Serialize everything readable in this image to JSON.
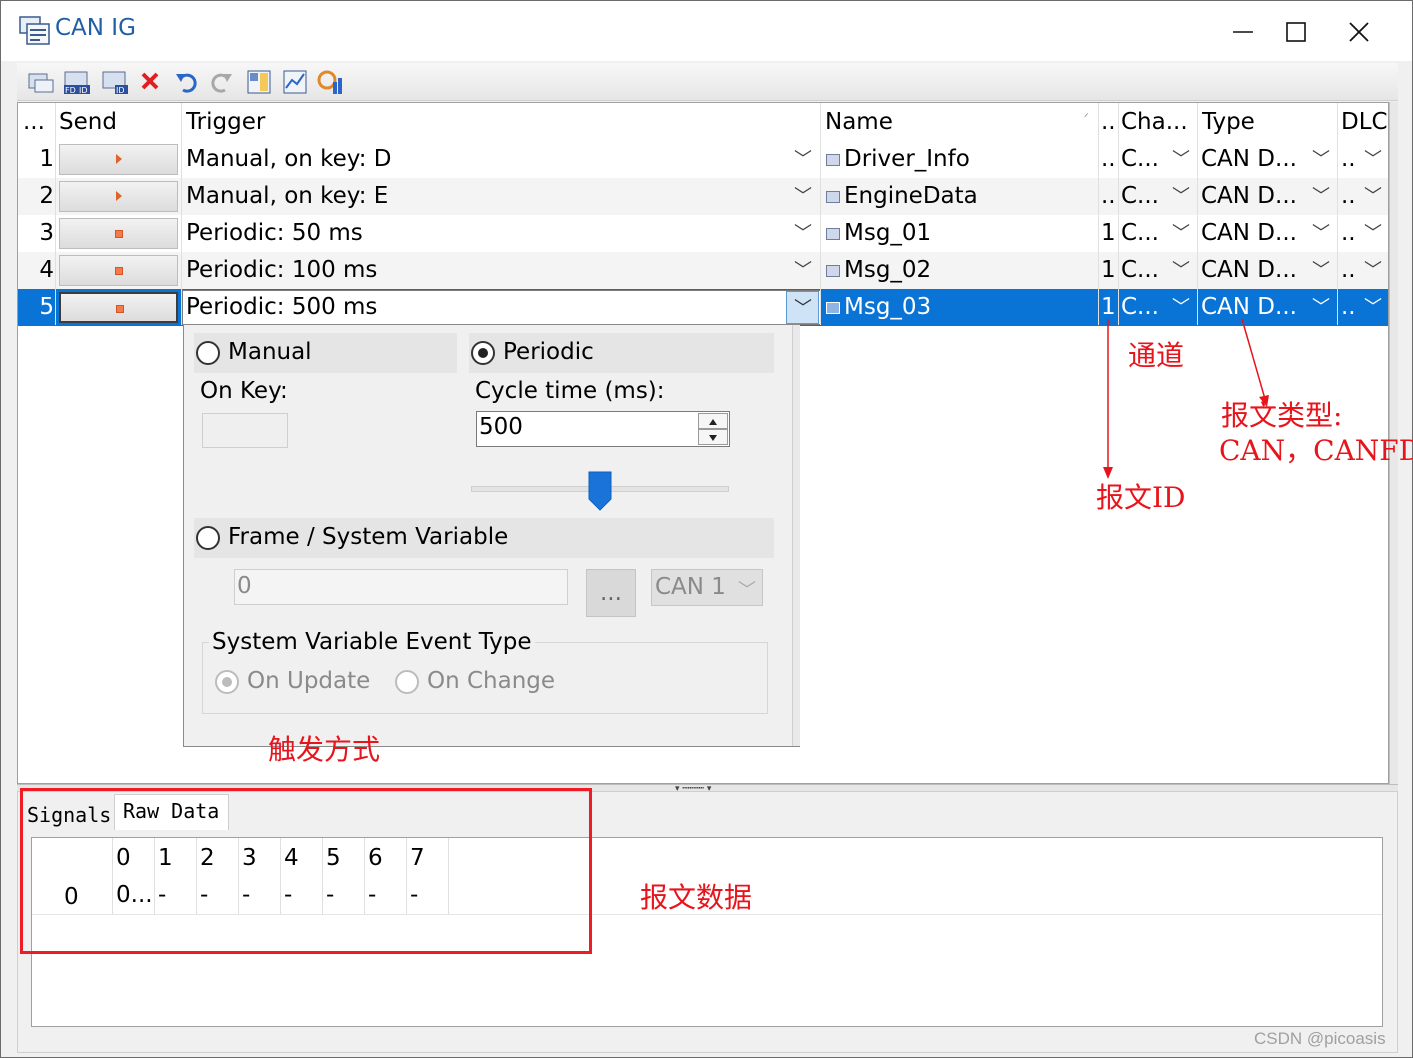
{
  "window": {
    "title": "CAN IG"
  },
  "columns": {
    "index": "...",
    "send": "Send",
    "trigger": "Trigger",
    "name": "Name",
    "id": "..",
    "channel": "Cha...",
    "type": "Type",
    "dlc": "DLC"
  },
  "rows": [
    {
      "index": "1",
      "send": "arrow",
      "trigger": "Manual, on key: D",
      "name": "Driver_Info",
      "id": "..",
      "channel": "C...",
      "type": "CAN D...",
      "dlc": ".."
    },
    {
      "index": "2",
      "send": "arrow",
      "trigger": "Manual, on key: E",
      "name": "EngineData",
      "id": "..",
      "channel": "C...",
      "type": "CAN D...",
      "dlc": ".."
    },
    {
      "index": "3",
      "send": "square",
      "trigger": "Periodic: 50 ms",
      "name": "Msg_01",
      "id": "1",
      "channel": "C...",
      "type": "CAN D...",
      "dlc": ".."
    },
    {
      "index": "4",
      "send": "square",
      "trigger": "Periodic: 100 ms",
      "name": "Msg_02",
      "id": "1",
      "channel": "C...",
      "type": "CAN D...",
      "dlc": ".."
    },
    {
      "index": "5",
      "send": "square",
      "trigger": "Periodic: 500 ms",
      "name": "Msg_03",
      "id": "1",
      "channel": "C...",
      "type": "CAN D...",
      "dlc": ".."
    }
  ],
  "trigger_editor": {
    "manual_label": "Manual",
    "on_key_label": "On Key:",
    "on_key_value": "",
    "periodic_label": "Periodic",
    "cycle_time_label": "Cycle time (ms):",
    "cycle_time_value": "500",
    "slider_value": 0.5,
    "frame_sysvar_label": "Frame / System Variable",
    "frame_value": "0",
    "browse_label": "...",
    "channel_value": "CAN 1",
    "event_type_label": "System Variable Event Type",
    "on_update_label": "On Update",
    "on_change_label": "On Change",
    "selected_mode": "Periodic"
  },
  "bottom_tabs": {
    "signals": "Signals",
    "raw_data": "Raw Data"
  },
  "raw_data": {
    "headers": [
      "0",
      "1",
      "2",
      "3",
      "4",
      "5",
      "6",
      "7"
    ],
    "row_label": "0",
    "values": [
      "0...",
      "-",
      "-",
      "-",
      "-",
      "-",
      "-",
      "-"
    ]
  },
  "annotations": {
    "channel": "通道",
    "msg_type_1": "报文类型:",
    "msg_type_2": "CAN，CANFD",
    "msg_id": "报文ID",
    "trigger_mode": "触发方式",
    "msg_data": "报文数据"
  },
  "watermark": "CSDN @picoasis",
  "colors": {
    "selection": "#0a74d6",
    "annotation": "#e8141c",
    "title": "#1f5fa8"
  }
}
